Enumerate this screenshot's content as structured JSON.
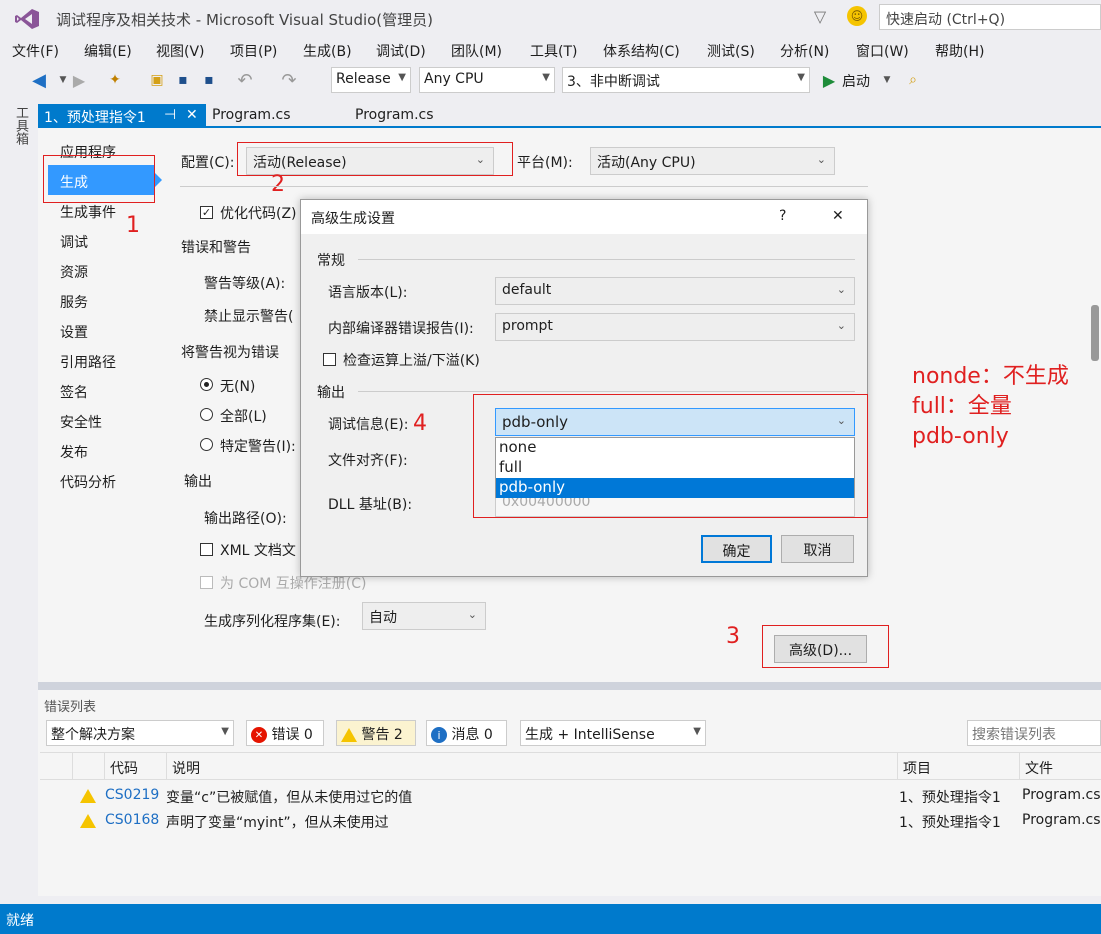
{
  "window": {
    "title": "调试程序及相关技术 - Microsoft Visual Studio(管理员)",
    "quick_launch": "快速启动 (Ctrl+Q)"
  },
  "menu": [
    "文件(F)",
    "编辑(E)",
    "视图(V)",
    "项目(P)",
    "生成(B)",
    "调试(D)",
    "团队(M)",
    "工具(T)",
    "体系结构(C)",
    "测试(S)",
    "分析(N)",
    "窗口(W)",
    "帮助(H)"
  ],
  "toolbar": {
    "config": "Release",
    "platform": "Any CPU",
    "startup": "3、非中断调试",
    "start_label": "启动"
  },
  "toolbox_label": "工具箱",
  "tabs": {
    "active": "1、预处理指令1",
    "pin": "⊣",
    "close": "✕",
    "t2": "Program.cs",
    "t3": "Program.cs"
  },
  "nav": [
    "应用程序",
    "生成",
    "生成事件",
    "调试",
    "资源",
    "服务",
    "设置",
    "引用路径",
    "签名",
    "安全性",
    "发布",
    "代码分析"
  ],
  "build": {
    "config_label": "配置(C):",
    "config_value": "活动(Release)",
    "platform_label": "平台(M):",
    "platform_value": "活动(Any CPU)",
    "optimize": "优化代码(Z)",
    "errors_section": "错误和警告",
    "warning_level": "警告等级(A):",
    "suppress": "禁止显示警告(",
    "treat_section": "将警告视为错误",
    "r_none": "无(N)",
    "r_all": "全部(L)",
    "r_specific": "特定警告(I):",
    "output_section": "输出",
    "output_path": "输出路径(O):",
    "xml_doc": "XML 文档文",
    "com": "为 COM 互操作注册(C)",
    "serialize": "生成序列化程序集(E):",
    "serialize_value": "自动",
    "advanced_button": "高级(D)..."
  },
  "dialog": {
    "title": "高级生成设置",
    "help": "?",
    "close": "✕",
    "general": "常规",
    "lang_label": "语言版本(L):",
    "lang_value": "default",
    "ice_label": "内部编译器错误报告(I):",
    "ice_value": "prompt",
    "overflow": "检查运算上溢/下溢(K)",
    "output": "输出",
    "debug_label": "调试信息(E):",
    "debug_value": "pdb-only",
    "options": [
      "none",
      "full",
      "pdb-only"
    ],
    "align_label": "文件对齐(F):",
    "dll_label": "DLL 基址(B):",
    "dll_value": "0x00400000",
    "ok": "确定",
    "cancel": "取消"
  },
  "annotations": {
    "n1": "1",
    "n2": "2",
    "n3": "3",
    "n4": "4",
    "note1": "nonde：不生成",
    "note2": "full：全量",
    "note3": "pdb-only"
  },
  "errors": {
    "title": "错误列表",
    "scope": "整个解决方案",
    "err": "错误 0",
    "warn": "警告 2",
    "msg": "消息 0",
    "source": "生成 + IntelliSense",
    "search": "搜索错误列表",
    "headers": {
      "code": "代码",
      "desc": "说明",
      "project": "项目",
      "file": "文件"
    },
    "rows": [
      {
        "code": "CS0219",
        "desc": "变量“c”已被赋值，但从未使用过它的值",
        "project": "1、预处理指令1",
        "file": "Program.cs"
      },
      {
        "code": "CS0168",
        "desc": "声明了变量“myint”，但从未使用过",
        "project": "1、预处理指令1",
        "file": "Program.cs"
      }
    ]
  },
  "status": "就绪",
  "colors": {
    "accent": "#007acc",
    "annotation": "#e02020",
    "selection": "#3399ff"
  }
}
